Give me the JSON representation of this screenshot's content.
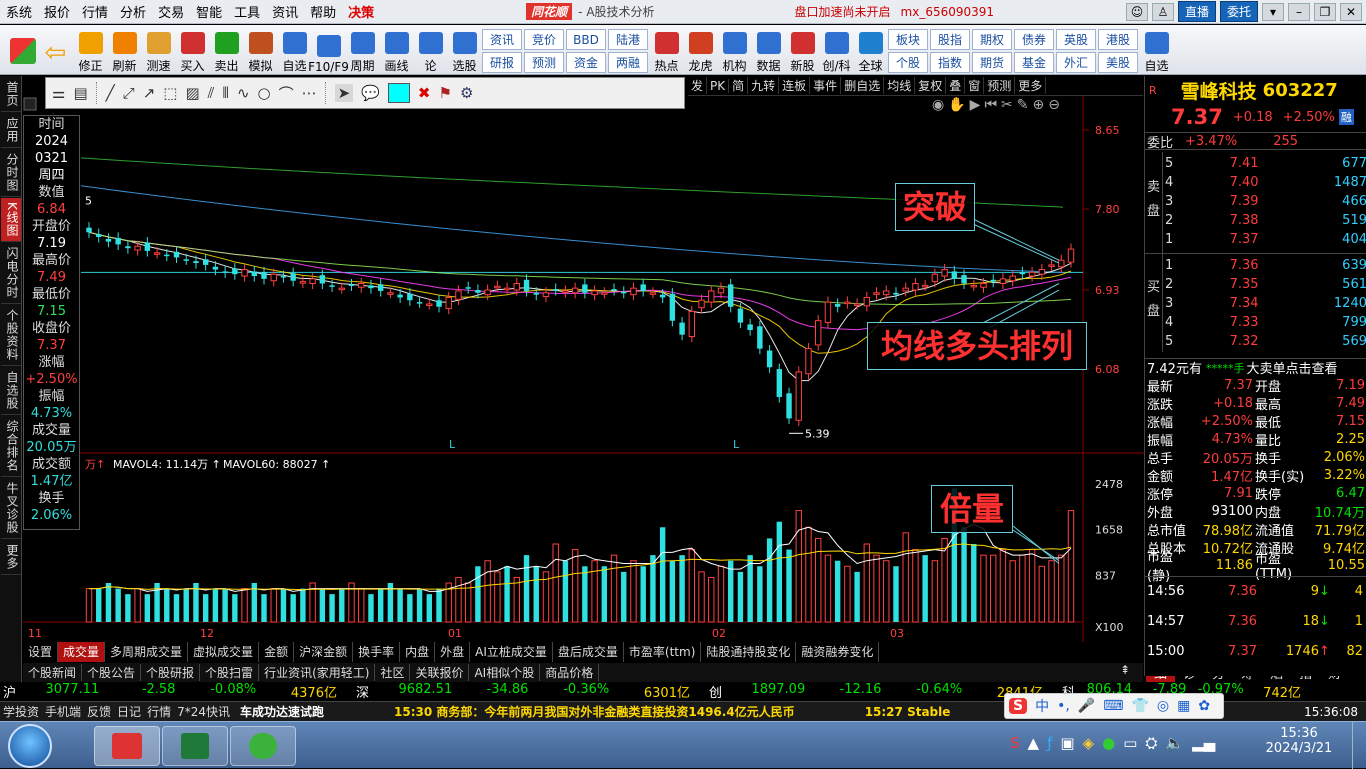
{
  "menu": {
    "items": [
      "系统",
      "报价",
      "行情",
      "分析",
      "交易",
      "智能",
      "工具",
      "资讯",
      "帮助"
    ],
    "highlight": "决策",
    "brand": "同花顺",
    "subtitle": "- A股技术分析",
    "status": "盘口加速尚未开启",
    "account": "mx_656090391",
    "btn_live": "直播",
    "btn_delegate": "委托"
  },
  "toolbar": {
    "items": [
      {
        "label": "修正",
        "icon": "up-arrow-icon"
      },
      {
        "label": "刷新",
        "icon": "refresh-icon"
      },
      {
        "label": "测速",
        "icon": "clock-icon"
      },
      {
        "label": "买入",
        "icon": "buy-icon"
      },
      {
        "label": "卖出",
        "icon": "sell-icon"
      },
      {
        "label": "模拟",
        "icon": "hammer-icon"
      },
      {
        "label": "自选",
        "icon": "favorite-icon"
      },
      {
        "label": "F10/F9",
        "icon": "f10-icon"
      },
      {
        "label": "周期",
        "icon": "period-icon"
      },
      {
        "label": "画线",
        "icon": "draw-icon"
      },
      {
        "label": "论",
        "icon": "forum-icon"
      },
      {
        "label": "选股",
        "icon": "select-icon"
      }
    ],
    "pairs": [
      [
        "资讯",
        "研报"
      ],
      [
        "竞价",
        "预测"
      ],
      [
        "BBD",
        "资金"
      ],
      [
        "陆港",
        "两融"
      ]
    ],
    "items2": [
      {
        "label": "热点"
      },
      {
        "label": "龙虎"
      },
      {
        "label": "机构"
      },
      {
        "label": "数据"
      },
      {
        "label": "新股"
      },
      {
        "label": "创/科"
      },
      {
        "label": "全球"
      }
    ],
    "pairs2": [
      [
        "板块",
        "个股"
      ],
      [
        "股指",
        "指数"
      ],
      [
        "期权",
        "期货"
      ],
      [
        "债券",
        "基金"
      ],
      [
        "英股",
        "外汇"
      ],
      [
        "港股",
        "美股"
      ]
    ],
    "last": "自选"
  },
  "lefttabs": [
    "首页",
    "应用",
    "分时图",
    "K线图",
    "闪电分时",
    "个股资料",
    "自选股",
    "综合排名",
    "牛叉诊股",
    "更多"
  ],
  "drawbar": {
    "color": "#00ffff"
  },
  "chartnav": [
    "发",
    "PK",
    "简",
    "九转",
    "连板",
    "事件",
    "删自选",
    "均线",
    "复权",
    "叠",
    "窗",
    "预测",
    "更多"
  ],
  "info": {
    "time_label": "时间",
    "year": "2024",
    "date": "0321",
    "weekday": "周四",
    "value_label": "数值",
    "value": "6.84",
    "open_label": "开盘价",
    "open": "7.19",
    "high_label": "最高价",
    "high": "7.49",
    "low_label": "最低价",
    "low": "7.15",
    "close_label": "收盘价",
    "close": "7.37",
    "chg_label": "涨幅",
    "chg": "+2.50%",
    "amp_label": "振幅",
    "amp": "4.73%",
    "vol_label": "成交量",
    "vol": "20.05万",
    "amt_label": "成交额",
    "amt": "1.47亿",
    "turn_label": "换手",
    "turn": "2.06%"
  },
  "chart_data": {
    "type": "candlestick",
    "price_axis": [
      "8.65",
      "7.80",
      "6.93",
      "6.08"
    ],
    "vol_axis": [
      "2478",
      "1658",
      "837",
      "X100"
    ],
    "months": [
      "11",
      "12",
      "01",
      "02",
      "03"
    ],
    "low_mark": "5.39",
    "start_mark": "5",
    "vol_legend": {
      "prefix": "万",
      "ma4": "MAVOL4: 11.14万",
      "ma60": "MAVOL60: 88027"
    },
    "markers": [
      "L",
      "L"
    ],
    "closes": [
      7.55,
      7.5,
      7.45,
      7.42,
      7.38,
      7.4,
      7.35,
      7.33,
      7.3,
      7.28,
      7.26,
      7.22,
      7.2,
      7.15,
      7.12,
      7.1,
      7.15,
      7.08,
      7.05,
      7.1,
      7.07,
      7.03,
      7.02,
      7.05,
      7.0,
      6.97,
      6.95,
      6.98,
      7.0,
      6.95,
      6.92,
      6.9,
      6.85,
      6.82,
      6.8,
      6.78,
      6.75,
      6.85,
      6.92,
      6.95,
      6.9,
      6.93,
      6.97,
      6.95,
      7.0,
      6.92,
      6.88,
      6.9,
      6.93,
      6.92,
      6.95,
      6.9,
      6.92,
      6.9,
      6.93,
      6.9,
      6.95,
      6.92,
      6.9,
      6.85,
      6.6,
      6.45,
      6.7,
      6.82,
      6.92,
      6.95,
      6.75,
      6.58,
      6.5,
      6.3,
      6.1,
      5.78,
      5.55,
      6.05,
      6.3,
      6.6,
      6.8,
      6.75,
      6.8,
      6.78,
      6.85,
      6.9,
      6.92,
      6.88,
      6.95,
      7.0,
      6.98,
      7.1,
      7.15,
      7.05,
      7.0,
      6.98,
      7.0,
      7.02,
      7.05,
      7.08,
      7.1,
      7.12,
      7.15,
      7.2,
      7.25,
      7.37
    ],
    "vols": [
      6,
      6,
      7,
      6,
      5,
      6,
      5,
      7,
      6,
      5,
      6,
      7,
      5,
      6,
      6,
      5,
      6,
      7,
      5,
      6,
      6,
      5,
      6,
      7,
      6,
      5,
      6,
      7,
      6,
      5,
      6,
      7,
      6,
      5,
      6,
      5,
      6,
      7,
      8,
      7,
      10,
      11,
      9,
      10,
      8,
      12,
      10,
      9,
      14,
      11,
      13,
      10,
      11,
      10,
      12,
      9,
      11,
      10,
      12,
      17,
      11,
      12,
      13,
      9,
      8,
      10,
      11,
      9,
      12,
      10,
      15,
      18,
      13,
      20,
      17,
      15,
      12,
      11,
      10,
      9,
      14,
      12,
      11,
      10,
      16,
      13,
      12,
      11,
      15,
      24,
      17,
      14,
      12,
      12,
      13,
      11,
      12,
      13,
      10,
      11,
      12,
      20
    ]
  },
  "annotations": {
    "breakout": "突破",
    "ma_bull": "均线多头排列",
    "double_vol": "倍量"
  },
  "bottomtabs": [
    "设置",
    "成交量",
    "多周期成交量",
    "虚拟成交量",
    "金额",
    "沪深金额",
    "换手率",
    "内盘",
    "外盘",
    "AI立桩成交量",
    "盘后成交量",
    "市盈率(ttm)",
    "陆股通持股变化",
    "融资融券变化"
  ],
  "newstabs": [
    "个股新闻",
    "个股公告",
    "个股研报",
    "个股扫雷",
    "行业资讯(家用轻工)",
    "社区",
    "关联报价",
    "AI相似个股",
    "商品价格"
  ],
  "rightnewstabs": [
    "细",
    "诊",
    "分",
    "筹",
    "焰",
    "指",
    "财"
  ],
  "stock": {
    "name": "雪峰科技",
    "code": "603227",
    "price": "7.37",
    "chg": "+0.18",
    "pct": "+2.50%",
    "tag": "融",
    "wb_label": "委比",
    "wb": "+3.47%",
    "wb_diff": "255",
    "sell": [
      [
        "5",
        "7.41",
        "677"
      ],
      [
        "4",
        "7.40",
        "1487"
      ],
      [
        "3",
        "7.39",
        "466"
      ],
      [
        "2",
        "7.38",
        "519"
      ],
      [
        "1",
        "7.37",
        "404"
      ]
    ],
    "buy": [
      [
        "1",
        "7.36",
        "639"
      ],
      [
        "2",
        "7.35",
        "561"
      ],
      [
        "3",
        "7.34",
        "1240"
      ],
      [
        "4",
        "7.33",
        "799"
      ],
      [
        "5",
        "7.32",
        "569"
      ]
    ],
    "sell_label": "卖盘",
    "buy_label": "买盘",
    "bigorder": {
      "price": "7.42元有",
      "stars": "*****手",
      "text": "大卖单点击查看"
    },
    "stats": [
      [
        "最新",
        "7.37",
        "开盘",
        "7.19"
      ],
      [
        "涨跌",
        "+0.18",
        "最高",
        "7.49"
      ],
      [
        "涨幅",
        "+2.50%",
        "最低",
        "7.15"
      ],
      [
        "振幅",
        "4.73%",
        "量比",
        "2.25"
      ],
      [
        "总手",
        "20.05万",
        "换手",
        "2.06%"
      ],
      [
        "金额",
        "1.47亿",
        "换手(实)",
        "3.22%"
      ],
      [
        "涨停",
        "7.91",
        "跌停",
        "6.47"
      ],
      [
        "外盘",
        "93100",
        "内盘",
        "10.74万"
      ],
      [
        "总市值",
        "78.98亿",
        "流通值",
        "71.79亿"
      ],
      [
        "总股本",
        "10.72亿",
        "流通股",
        "9.74亿"
      ],
      [
        "市盈(静)",
        "11.86",
        "市盈(TTM)",
        "10.55"
      ]
    ],
    "ticks": [
      [
        "14:56",
        "7.36",
        "9",
        "4"
      ],
      [
        "14:57",
        "7.36",
        "18",
        "1"
      ],
      [
        "15:00",
        "7.37",
        "1746",
        "82"
      ]
    ]
  },
  "index": [
    [
      "沪",
      "3077.11",
      "-2.58",
      "-0.08%",
      "4376亿"
    ],
    [
      "深",
      "9682.51",
      "-34.86",
      "-0.36%",
      "6301亿"
    ],
    [
      "创",
      "1897.09",
      "-12.16",
      "-0.64%",
      "2841亿"
    ],
    [
      "科",
      "806.14",
      "-7.89",
      "-0.97%",
      "742亿"
    ]
  ],
  "statusbar": {
    "items": [
      "学投资",
      "手机端",
      "反馈",
      "日记",
      "行情",
      "7*24快讯"
    ],
    "broker": "车成功达速试跑",
    "news": "15:30 商务部：今年前两月我国对外非金融类直接投资1496.4亿元人民币",
    "news2": "15:27 Stable",
    "time": "15:36:08"
  },
  "taskbar": {
    "time": "15:36",
    "date": "2024/3/21"
  }
}
